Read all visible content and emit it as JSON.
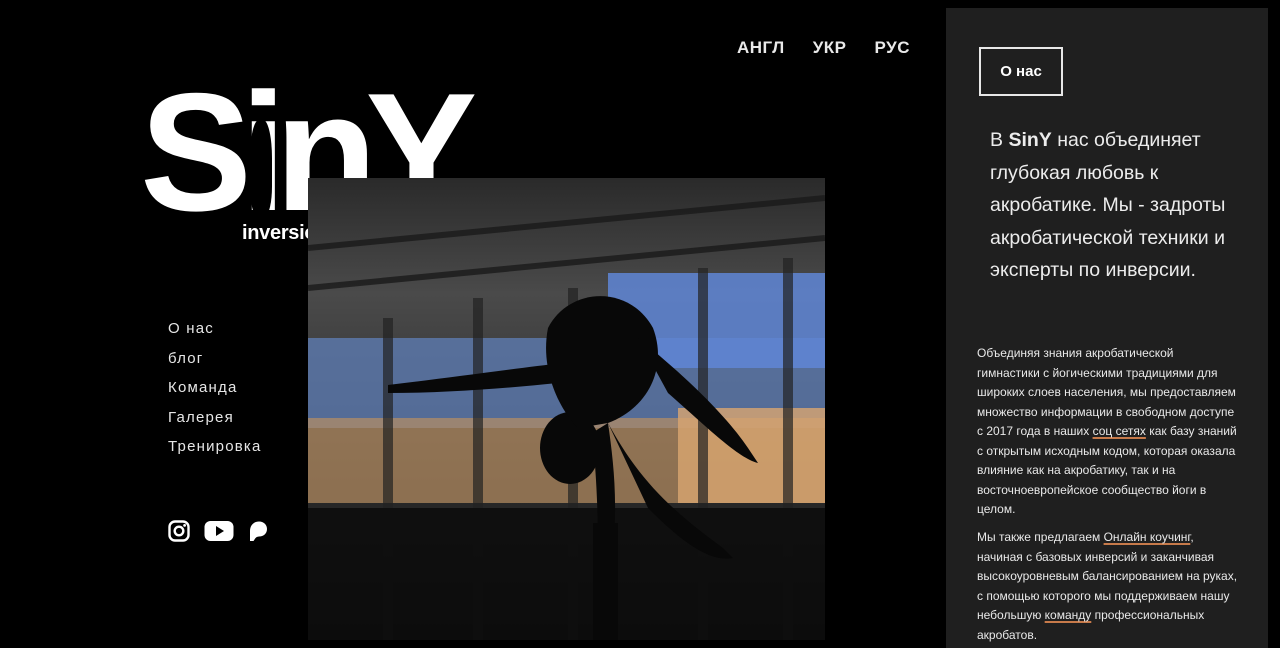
{
  "lang": [
    "АНГЛ",
    "УКР",
    "РУС"
  ],
  "logo": {
    "word": "SinY",
    "sub": "inversion yoga"
  },
  "nav": [
    "О нас",
    "блог",
    "Команда",
    "Галерея",
    "Тренировка"
  ],
  "social": [
    "instagram-icon",
    "youtube-icon",
    "patreon-icon"
  ],
  "panel": {
    "button": "О нас",
    "lead_pre": "В ",
    "lead_brand": "SinY",
    "lead_post": " нас объединяет глубокая любовь к акробатике. Мы - задроты акробатической техники и эксперты по инверсии.",
    "p1_a": "Объединяя знания акробатической гимнастики с йогическими традициями для широких слоев населения, мы предоставляем множество информации в свободном доступе с 2017 года в наших ",
    "p1_link": "соц сетях",
    "p1_b": " как базу знаний с открытым исходным кодом, которая оказала влияние как на акробатику, так и на восточноевропейское сообщество йоги в целом.",
    "p2_a": "Мы также предлагаем ",
    "p2_link1": "Онлайн коучинг",
    "p2_b": ", начиная с базовых инверсий и заканчивая высокоуровневым балансированием на руках, с помощью которого мы поддерживаем нашу небольшую ",
    "p2_link2": "команду",
    "p2_c": " профессиональных акробатов."
  },
  "colors": {
    "background": "#000000",
    "panel": "#1f1f1f",
    "link_underline": "#c77a4a"
  }
}
